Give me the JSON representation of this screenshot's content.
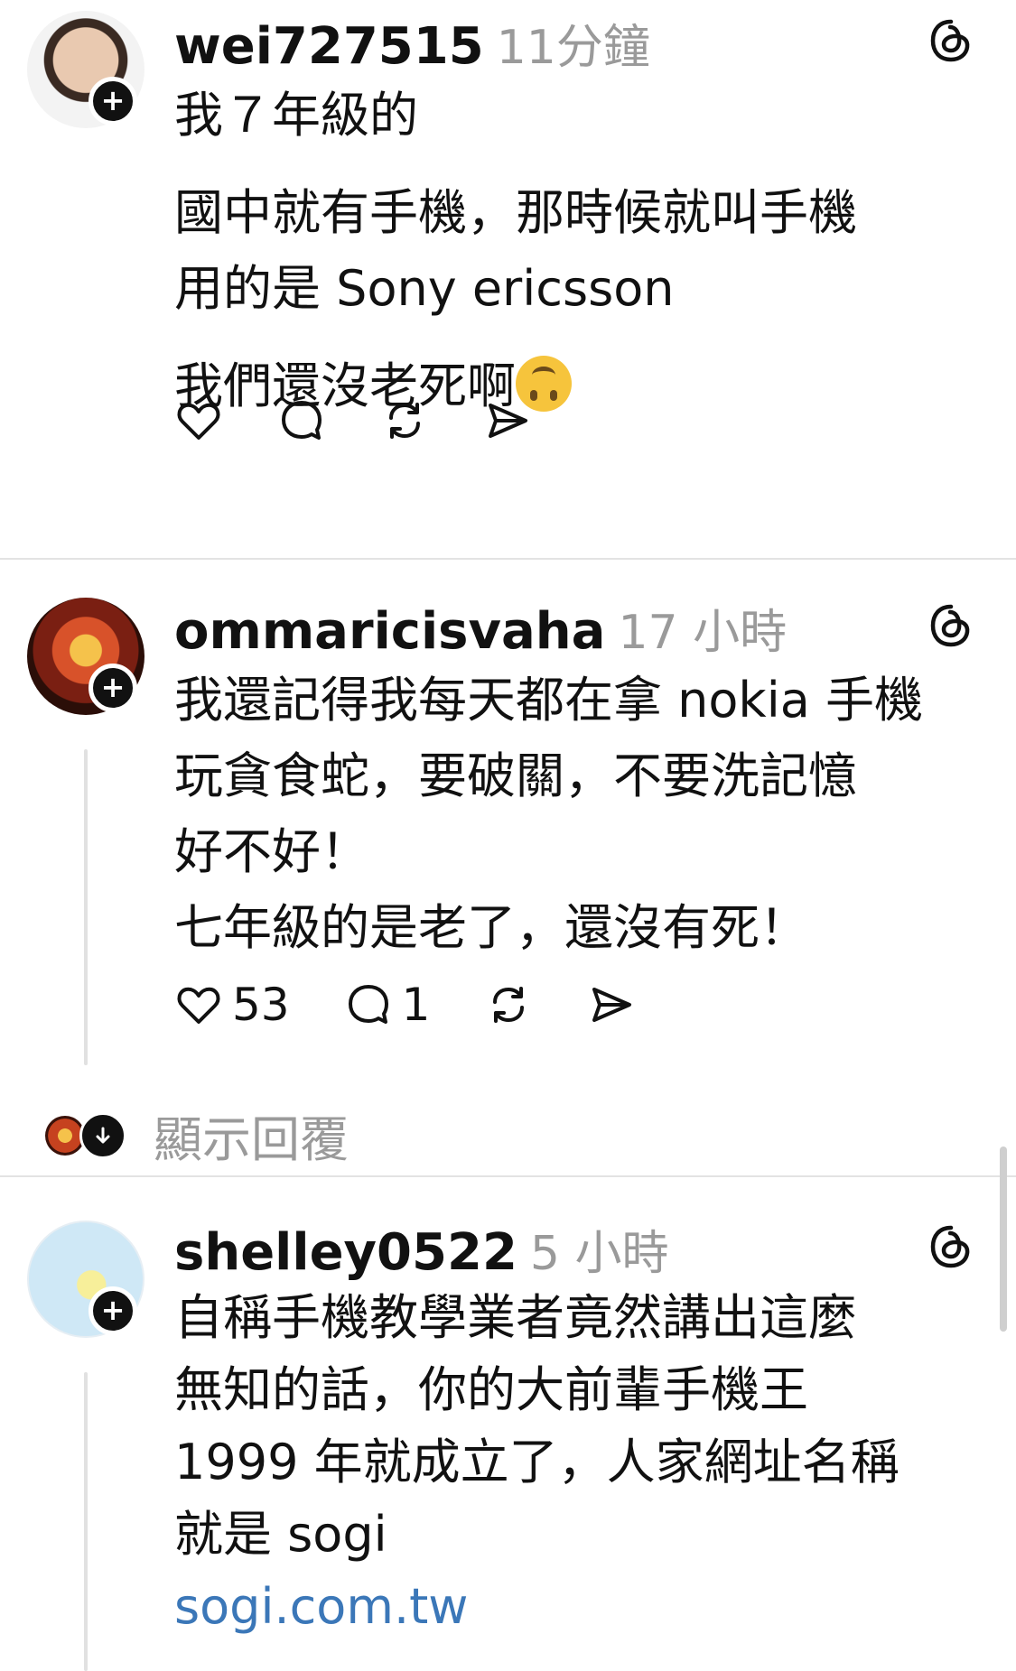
{
  "posts": [
    {
      "username": "wei727515",
      "time": "11分鐘",
      "lines": [
        "我７年級的",
        "",
        "國中就有手機，那時候就叫手機",
        "用的是 Sony ericsson",
        "",
        "我們還沒老死啊"
      ],
      "emoji": "upside-down-face",
      "likes": "",
      "replies": ""
    },
    {
      "username": "ommaricisvaha",
      "time": "17 小時",
      "lines": [
        "我還記得我每天都在拿 nokia 手機",
        "玩貪食蛇，要破關，不要洗記憶",
        "好不好！",
        "七年級的是老了，還沒有死！"
      ],
      "likes": "53",
      "replies": "1",
      "show_replies_label": "顯示回覆"
    },
    {
      "username": "shelley0522",
      "time": "5 小時",
      "lines": [
        "自稱手機教學業者竟然講出這麼",
        "無知的話，你的大前輩手機王",
        "1999 年就成立了，人家網址名稱",
        "就是 sogi"
      ],
      "link": "sogi.com.tw"
    }
  ],
  "colors": {
    "text": "#111111",
    "muted": "#9a9a9a",
    "link": "#3b77b8",
    "divider": "#e3e3e3"
  },
  "icons": [
    "threads-icon",
    "heart-icon",
    "comment-icon",
    "repost-icon",
    "share-icon",
    "follow-plus-icon",
    "chevron-down-icon"
  ]
}
